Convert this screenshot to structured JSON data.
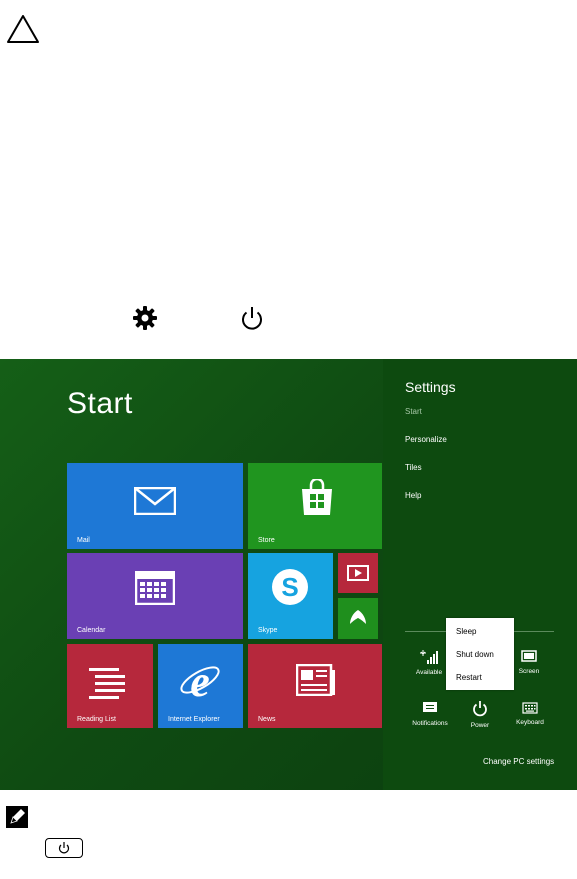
{
  "icons": {
    "warning": "warning-triangle-icon",
    "gear": "gear-icon",
    "power": "power-icon",
    "note": "pencil-note-icon",
    "power_key": "power-button-key-icon"
  },
  "start_screen": {
    "title": "Start",
    "background": "#0f4b12",
    "tiles": [
      {
        "label": "Mail",
        "color": "#1e78d6",
        "icon": "mail-icon"
      },
      {
        "label": "Store",
        "color": "#20951f",
        "icon": "store-bag-icon"
      },
      {
        "label": "Calendar",
        "color": "#6a40b4",
        "icon": "calendar-icon"
      },
      {
        "label": "Skype",
        "color": "#16a3e0",
        "icon": "skype-icon"
      },
      {
        "label": "",
        "color": "#b6283c",
        "icon": "video-icon"
      },
      {
        "label": "",
        "color": "#1f8f1d",
        "icon": "xbox-games-icon"
      },
      {
        "label": "Reading List",
        "color": "#b6283c",
        "icon": "reading-list-icon"
      },
      {
        "label": "Internet Explorer",
        "color": "#1e78d6",
        "icon": "internet-explorer-icon"
      },
      {
        "label": "News",
        "color": "#b6283c",
        "icon": "news-icon"
      }
    ]
  },
  "settings": {
    "title": "Settings",
    "items": [
      "Start",
      "Personalize",
      "Tiles",
      "Help"
    ],
    "quick": [
      {
        "label": "Available",
        "icon": "network-signal-icon"
      },
      {
        "label": "Screen",
        "icon": "screen-icon"
      },
      {
        "label": "Notifications",
        "icon": "notifications-icon"
      },
      {
        "label": "Power",
        "icon": "power-icon"
      },
      {
        "label": "Keyboard",
        "icon": "keyboard-icon"
      }
    ],
    "power_menu": [
      "Sleep",
      "Shut down",
      "Restart"
    ],
    "change_pc_settings": "Change PC settings"
  }
}
